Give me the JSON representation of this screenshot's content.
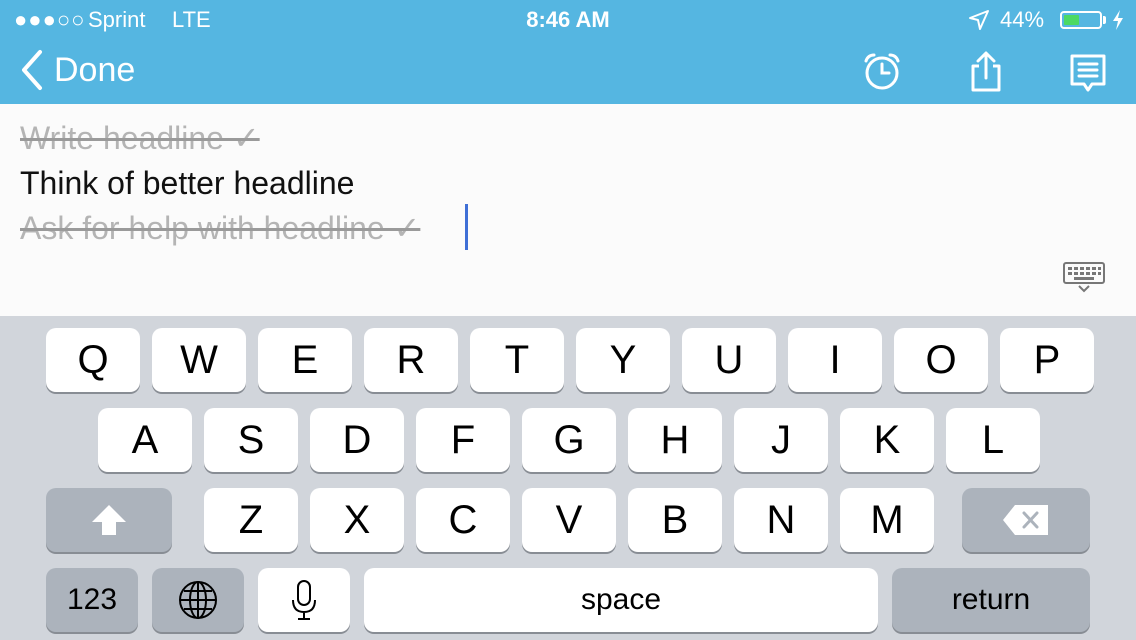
{
  "status_bar": {
    "signal": "●●●○○",
    "carrier": "Sprint",
    "network": "LTE",
    "time": "8:46 AM",
    "battery_percent": "44%",
    "battery_level": 0.44,
    "charging_icon": "bolt-icon",
    "location_icon": "location-arrow-icon"
  },
  "nav": {
    "back_label": "Done",
    "icons": [
      "alarm-icon",
      "share-icon",
      "notes-list-icon"
    ],
    "accent": "#55b6e1"
  },
  "content": {
    "lines": [
      {
        "text": "Write headline ✓",
        "completed": true
      },
      {
        "text": "Think of better headline",
        "completed": false
      },
      {
        "text": "Ask for help with headline ✓",
        "completed": true
      }
    ],
    "dismiss_icon": "keyboard-dismiss-icon"
  },
  "keyboard": {
    "row1": [
      "Q",
      "W",
      "E",
      "R",
      "T",
      "Y",
      "U",
      "I",
      "O",
      "P"
    ],
    "row2": [
      "A",
      "S",
      "D",
      "F",
      "G",
      "H",
      "J",
      "K",
      "L"
    ],
    "row3": [
      "Z",
      "X",
      "C",
      "V",
      "B",
      "N",
      "M"
    ],
    "numbers_label": "123",
    "space_label": "space",
    "return_label": "return",
    "shift_icon": "shift-icon",
    "delete_icon": "delete-icon",
    "globe_icon": "globe-icon",
    "mic_icon": "microphone-icon"
  }
}
